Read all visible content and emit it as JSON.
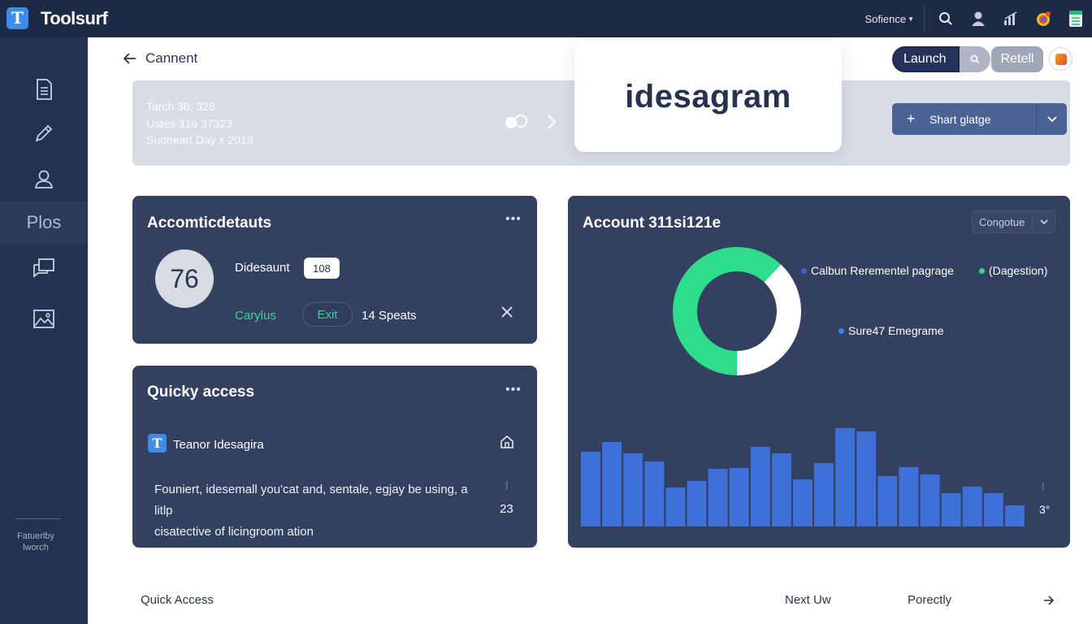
{
  "app": {
    "logo_letter": "T",
    "name": "Toolsurf"
  },
  "topbar": {
    "select_label": "Sofience"
  },
  "sidebar": {
    "label_item": "Plos",
    "footer_line1": "Fatuerlby",
    "footer_line2": "lworch"
  },
  "header": {
    "back_label": "Cannent"
  },
  "banner": {
    "line1": "Tarch 36, 328",
    "line2": "Ustes 31o 37323",
    "line3": "Suoneart Day x 2018"
  },
  "floating_card": {
    "title": "idesagram"
  },
  "toolbar": {
    "launch_label": "Launch",
    "retell_label": "Retell",
    "share_label": "Shart glatge"
  },
  "account_card": {
    "title": "Accomticdetauts",
    "avatar_text": "76",
    "label": "Didesaunt",
    "badge": "108",
    "link": "Carylus",
    "edit_label": "Exit",
    "meta": "14 Speats"
  },
  "quick_card": {
    "title": "Quicky access",
    "logo_letter": "T",
    "item_name": "Teanor Idesagira",
    "desc_line1": "Founiert, idesemall you'cat and, sentale, egjay be using, a litlp",
    "desc_line2": "cisatective of licingroom ation",
    "count": "23"
  },
  "chart_card": {
    "title": "Account 311si121e",
    "dropdown_label": "Congotue",
    "legend": [
      {
        "label": "Calbun Rerementel pagrage",
        "color": "#3f63d6"
      },
      {
        "label": "(Dagestion)",
        "color": "#2fdc8a"
      },
      {
        "label": "Sure47 Emegrame",
        "color": "#3f7fe8"
      }
    ],
    "axis_value": "3°"
  },
  "chart_data": [
    {
      "type": "pie",
      "values": [
        62,
        38
      ],
      "colors": [
        "#2fdc8a",
        "#ffffff"
      ],
      "title": ""
    },
    {
      "type": "bar",
      "values": [
        92,
        104,
        90,
        80,
        48,
        56,
        71,
        72,
        98,
        90,
        58,
        78,
        121,
        117,
        62,
        73,
        64,
        41,
        49,
        41,
        26
      ],
      "ylim": [
        0,
        130
      ],
      "color": "#3f6fd8",
      "title": ""
    }
  ],
  "footer": {
    "left_label": "Quick Access",
    "mid_label": "Next Uw",
    "right_label": "Porectly"
  }
}
